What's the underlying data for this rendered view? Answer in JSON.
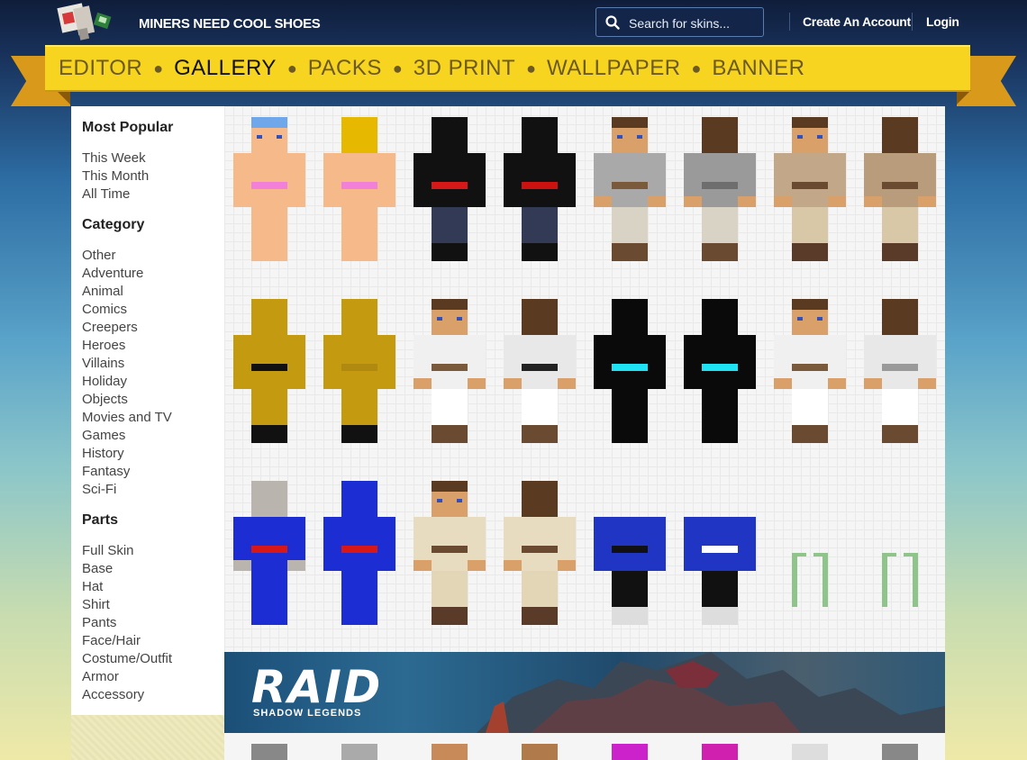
{
  "header": {
    "site_name": "MINERS NEED COOL SHOES",
    "search_placeholder": "Search for skins...",
    "create_account": "Create An Account",
    "login": "Login"
  },
  "nav": {
    "items": [
      {
        "label": "EDITOR",
        "active": false
      },
      {
        "label": "GALLERY",
        "active": true
      },
      {
        "label": "PACKS",
        "active": false
      },
      {
        "label": "3D PRINT",
        "active": false
      },
      {
        "label": "WALLPAPER",
        "active": false
      },
      {
        "label": "BANNER",
        "active": false
      }
    ]
  },
  "sidebar": {
    "popular_heading": "Most Popular",
    "popular": [
      "This Week",
      "This Month",
      "All Time"
    ],
    "category_heading": "Category",
    "categories": [
      "Other",
      "Adventure",
      "Animal",
      "Comics",
      "Creepers",
      "Heroes",
      "Villains",
      "Holiday",
      "Objects",
      "Movies and TV",
      "Games",
      "History",
      "Fantasy",
      "Sci-Fi"
    ],
    "parts_heading": "Parts",
    "parts": [
      "Full Skin",
      "Base",
      "Hat",
      "Shirt",
      "Pants",
      "Face/Hair",
      "Costume/Outfit",
      "Armor",
      "Accessory"
    ]
  },
  "ad": {
    "title": "RAID",
    "subtitle": "SHADOW LEGENDS"
  },
  "skins": [
    {
      "name": "bikini-girl-front",
      "hair": "#6fa8ea",
      "skin": "#f6b98a",
      "shirt": "#f6b98a",
      "accent": "#f27fd8",
      "pants": "#f6b98a",
      "shoes": "#f6b98a",
      "back": false
    },
    {
      "name": "bikini-girl-back",
      "hair": "#e6b800",
      "skin": "#f6b98a",
      "shirt": "#f6b98a",
      "accent": "#f27fd8",
      "pants": "#f6b98a",
      "shoes": "#f6b98a",
      "back": true
    },
    {
      "name": "red-black-girl-front",
      "hair": "#111111",
      "skin": "#111111",
      "shirt": "#111111",
      "accent": "#d61818",
      "pants": "#333a55",
      "shoes": "#111111",
      "back": false
    },
    {
      "name": "red-black-girl-back",
      "hair": "#111111",
      "skin": "#111111",
      "shirt": "#111111",
      "accent": "#cc1111",
      "pants": "#333a55",
      "shoes": "#111111",
      "back": true
    },
    {
      "name": "grey-jedi-front",
      "hair": "#5a3a20",
      "skin": "#d9a06a",
      "shirt": "#a9a9a9",
      "accent": "#7a5a3a",
      "pants": "#d9d3c5",
      "shoes": "#6a4a30",
      "back": false
    },
    {
      "name": "grey-jedi-back",
      "hair": "#5a3a20",
      "skin": "#d9a06a",
      "shirt": "#9a9a9a",
      "accent": "#6e6e6e",
      "pants": "#d9d3c5",
      "shoes": "#6a4a30",
      "back": true
    },
    {
      "name": "tan-jedi-front",
      "hair": "#5a3a20",
      "skin": "#d9a06a",
      "shirt": "#c2a888",
      "accent": "#6a4a30",
      "pants": "#d9c8a8",
      "shoes": "#5a3a28",
      "back": false
    },
    {
      "name": "tan-jedi-back",
      "hair": "#5a3a20",
      "skin": "#d9a06a",
      "shirt": "#b89c7c",
      "accent": "#6a4a30",
      "pants": "#d9c8a8",
      "shoes": "#5a3a28",
      "back": true
    },
    {
      "name": "golden-creature-front",
      "hair": "#c49a10",
      "skin": "#c49a10",
      "shirt": "#c49a10",
      "accent": "#111111",
      "pants": "#c49a10",
      "shoes": "#111111",
      "back": false
    },
    {
      "name": "golden-creature-back",
      "hair": "#c49a10",
      "skin": "#c49a10",
      "shirt": "#c49a10",
      "accent": "#b08a10",
      "pants": "#c49a10",
      "shoes": "#111111",
      "back": true
    },
    {
      "name": "white-jedi-front",
      "hair": "#5a3a20",
      "skin": "#d9a06a",
      "shirt": "#f0f0f0",
      "accent": "#7a5a3a",
      "pants": "#ffffff",
      "shoes": "#6a4a30",
      "back": false
    },
    {
      "name": "white-jedi-back",
      "hair": "#5a3a20",
      "skin": "#d9a06a",
      "shirt": "#e8e8e8",
      "accent": "#222222",
      "pants": "#ffffff",
      "shoes": "#6a4a30",
      "back": true
    },
    {
      "name": "cyan-creeper-front",
      "hair": "#0a0a0a",
      "skin": "#0a0a0a",
      "shirt": "#0a0a0a",
      "accent": "#1de3f5",
      "pants": "#0a0a0a",
      "shoes": "#0a0a0a",
      "back": false
    },
    {
      "name": "cyan-creeper-back",
      "hair": "#0a0a0a",
      "skin": "#0a0a0a",
      "shirt": "#0a0a0a",
      "accent": "#1de3f5",
      "pants": "#0a0a0a",
      "shoes": "#0a0a0a",
      "back": true
    },
    {
      "name": "white-jedi2-front",
      "hair": "#5a3a20",
      "skin": "#d9a06a",
      "shirt": "#f0f0f0",
      "accent": "#7a5a3a",
      "pants": "#ffffff",
      "shoes": "#6a4a30",
      "back": false
    },
    {
      "name": "white-jedi2-back",
      "hair": "#5a3a20",
      "skin": "#d9a06a",
      "shirt": "#e8e8e8",
      "accent": "#9a9a9a",
      "pants": "#ffffff",
      "shoes": "#6a4a30",
      "back": true
    },
    {
      "name": "blue-hero-front",
      "hair": "#b9b5ae",
      "skin": "#b9b5ae",
      "shirt": "#1c2dd4",
      "accent": "#d61818",
      "pants": "#1c2dd4",
      "shoes": "#1c2dd4",
      "back": false
    },
    {
      "name": "blue-hero-back",
      "hair": "#1c2dd4",
      "skin": "#1c2dd4",
      "shirt": "#1c2dd4",
      "accent": "#d61818",
      "pants": "#1c2dd4",
      "shoes": "#1c2dd4",
      "back": true
    },
    {
      "name": "cream-jedi-front",
      "hair": "#5a3a20",
      "skin": "#d9a06a",
      "shirt": "#e8dcc0",
      "accent": "#6a4a30",
      "pants": "#e2d6b6",
      "shoes": "#5a3a28",
      "back": false
    },
    {
      "name": "cream-jedi-back",
      "hair": "#5a3a20",
      "skin": "#d9a06a",
      "shirt": "#e8dcc0",
      "accent": "#6a4a30",
      "pants": "#e2d6b6",
      "shoes": "#5a3a28",
      "back": true
    },
    {
      "name": "tpa-shirt-front",
      "hair": "none",
      "skin": "none",
      "shirt": "#2035c4",
      "accent": "#111111",
      "pants": "#111111",
      "shoes": "#dddddd",
      "back": false
    },
    {
      "name": "tpa-shirt-back",
      "hair": "none",
      "skin": "none",
      "shirt": "#2035c4",
      "accent": "#ffffff",
      "pants": "#111111",
      "shoes": "#dddddd",
      "back": true
    },
    {
      "name": "green-vine-front",
      "hair": "none",
      "skin": "none",
      "shirt": "none",
      "accent": "#8fc58a",
      "pants": "none",
      "shoes": "none",
      "back": false
    },
    {
      "name": "green-vine-back",
      "hair": "none",
      "skin": "none",
      "shirt": "none",
      "accent": "#8fc58a",
      "pants": "none",
      "shoes": "none",
      "back": true
    }
  ],
  "bottom_row_colors": [
    "#888888",
    "#aaaaaa",
    "#c98a5a",
    "#b07a4a",
    "#cc22cc",
    "#d020b0",
    "#dddddd",
    "#888888"
  ]
}
